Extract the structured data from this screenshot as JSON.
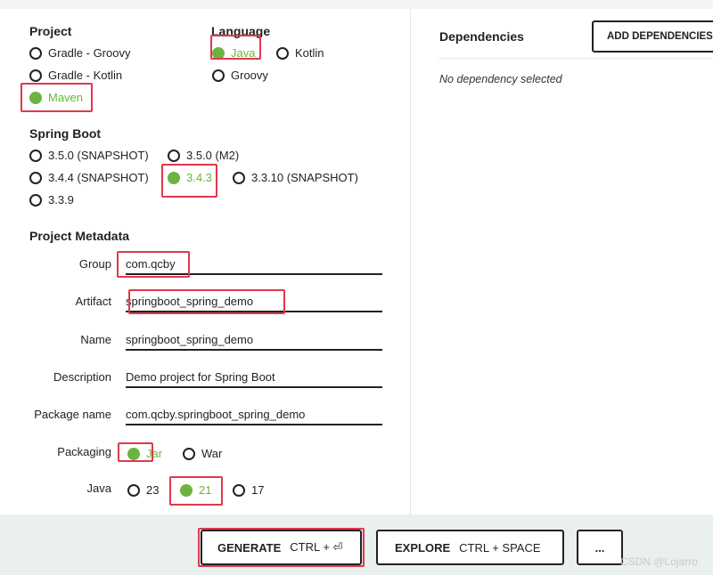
{
  "project": {
    "heading": "Project",
    "options": [
      "Gradle - Groovy",
      "Gradle - Kotlin",
      "Maven"
    ],
    "selected": "Maven"
  },
  "language": {
    "heading": "Language",
    "options": [
      "Java",
      "Kotlin",
      "Groovy"
    ],
    "selected": "Java"
  },
  "spring_boot": {
    "heading": "Spring Boot",
    "options": [
      "3.5.0 (SNAPSHOT)",
      "3.5.0 (M2)",
      "3.4.4 (SNAPSHOT)",
      "3.4.3",
      "3.3.10 (SNAPSHOT)",
      "3.3.9"
    ],
    "selected": "3.4.3"
  },
  "metadata": {
    "heading": "Project Metadata",
    "group": {
      "label": "Group",
      "value": "com.qcby"
    },
    "artifact": {
      "label": "Artifact",
      "value": "springboot_spring_demo"
    },
    "name": {
      "label": "Name",
      "value": "springboot_spring_demo"
    },
    "description": {
      "label": "Description",
      "value": "Demo project for Spring Boot"
    },
    "package_name": {
      "label": "Package name",
      "value": "com.qcby.springboot_spring_demo"
    },
    "packaging": {
      "label": "Packaging",
      "options": [
        "Jar",
        "War"
      ],
      "selected": "Jar"
    },
    "java": {
      "label": "Java",
      "options": [
        "23",
        "21",
        "17"
      ],
      "selected": "21"
    }
  },
  "dependencies": {
    "title": "Dependencies",
    "add_label": "ADD DEPENDENCIES...",
    "empty_text": "No dependency selected"
  },
  "footer": {
    "generate_label": "GENERATE",
    "generate_shortcut": "CTRL + ⏎",
    "explore_label": "EXPLORE",
    "explore_shortcut": "CTRL + SPACE",
    "more_label": "..."
  },
  "watermark": "CSDN @Lojarro",
  "colors": {
    "accent": "#6db33f",
    "highlight": "#e0384c",
    "footer_bg": "#eaf0f0"
  }
}
